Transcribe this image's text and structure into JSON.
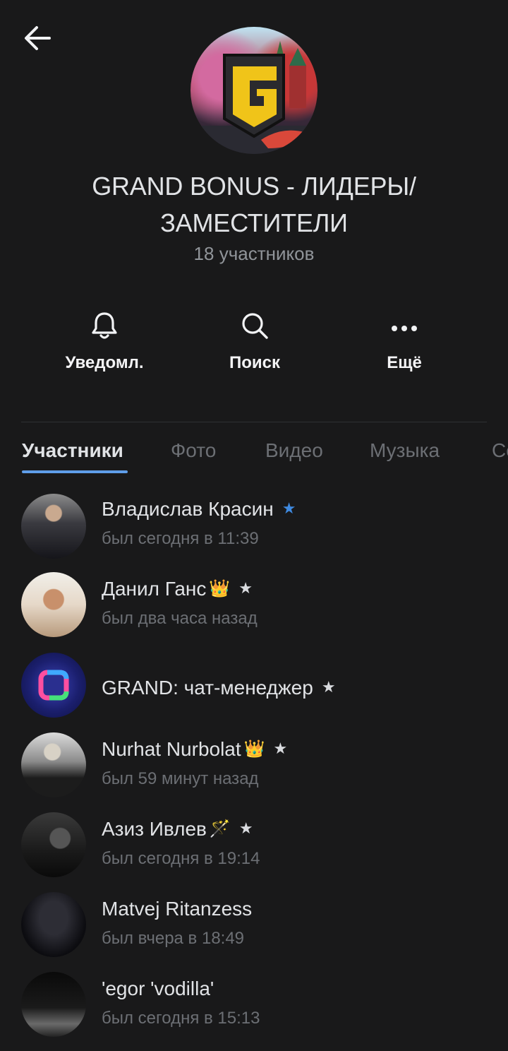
{
  "header": {
    "back_icon": "arrow-left-icon",
    "title_line1": "GRAND BONUS - ЛИДЕРЫ/",
    "title_line2": "ЗАМЕСТИТЕЛИ",
    "subtitle": "18 участников"
  },
  "actions": [
    {
      "label": "Уведомл.",
      "icon": "bell-icon"
    },
    {
      "label": "Поиск",
      "icon": "search-icon"
    },
    {
      "label": "Ещё",
      "icon": "more-icon"
    }
  ],
  "tabs": [
    "Участники",
    "Фото",
    "Видео",
    "Музыка",
    "Се"
  ],
  "active_tab": "Участники",
  "members": [
    {
      "name": "Владислав Красин",
      "emoji": "",
      "star": "blue",
      "status": "был сегодня в 11:39"
    },
    {
      "name": "Данил Ганс",
      "emoji": "👑",
      "star": "white",
      "status": "был два часа назад"
    },
    {
      "name": "GRAND: чат-менеджер",
      "emoji": "",
      "star": "white",
      "status": ""
    },
    {
      "name": "Nurhat Nurbolat",
      "emoji": "👑",
      "star": "white",
      "status": "был 59 минут назад"
    },
    {
      "name": "Азиз Ивлев",
      "emoji": "🪄",
      "star": "white",
      "status": "был сегодня в 19:14"
    },
    {
      "name": "Matvej Ritanzess",
      "emoji": "",
      "star": "",
      "status": "был вчера в 18:49"
    },
    {
      "name": "'egor 'vodilla'",
      "emoji": "",
      "star": "",
      "status": "был сегодня в 15:13"
    }
  ],
  "colors": {
    "background": "#19191a",
    "accent": "#5f9ee9",
    "star_blue": "#3f8ae0",
    "text_secondary": "#909499"
  }
}
